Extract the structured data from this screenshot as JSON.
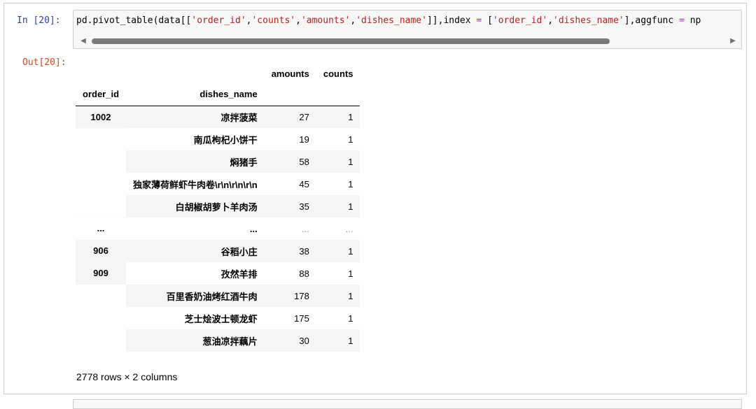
{
  "cell_in": {
    "prompt": "In  [20]:",
    "code_parts": [
      {
        "t": "pd.pivot_table(data[[",
        "c": ""
      },
      {
        "t": "'order_id'",
        "c": "str"
      },
      {
        "t": ",",
        "c": ""
      },
      {
        "t": "'counts'",
        "c": "str"
      },
      {
        "t": ",",
        "c": ""
      },
      {
        "t": "'amounts'",
        "c": "str"
      },
      {
        "t": ",",
        "c": ""
      },
      {
        "t": "'dishes_name'",
        "c": "str"
      },
      {
        "t": "]],index ",
        "c": ""
      },
      {
        "t": "=",
        "c": "op"
      },
      {
        "t": " [",
        "c": ""
      },
      {
        "t": "'order_id'",
        "c": "str"
      },
      {
        "t": ",",
        "c": ""
      },
      {
        "t": "'dishes_name'",
        "c": "str"
      },
      {
        "t": "],aggfunc ",
        "c": ""
      },
      {
        "t": "=",
        "c": "op"
      },
      {
        "t": " np",
        "c": ""
      }
    ]
  },
  "cell_out": {
    "prompt": "Out[20]:",
    "table": {
      "columns": [
        "amounts",
        "counts"
      ],
      "index_names": [
        "order_id",
        "dishes_name"
      ],
      "rows": [
        {
          "order_id": "1002",
          "dish": "凉拌菠菜",
          "amounts": "27",
          "counts": "1"
        },
        {
          "order_id": "",
          "dish": "南瓜枸杞小饼干",
          "amounts": "19",
          "counts": "1"
        },
        {
          "order_id": "",
          "dish": "焖猪手",
          "amounts": "58",
          "counts": "1"
        },
        {
          "order_id": "",
          "dish": "独家薄荷鲜虾牛肉卷\\r\\n\\r\\n\\r\\n",
          "amounts": "45",
          "counts": "1"
        },
        {
          "order_id": "",
          "dish": "白胡椒胡萝卜羊肉汤",
          "amounts": "35",
          "counts": "1"
        },
        {
          "order_id": "...",
          "dish": "...",
          "amounts": "...",
          "counts": "...",
          "ellipsis": true
        },
        {
          "order_id": "906",
          "dish": "谷稻小庄",
          "amounts": "38",
          "counts": "1"
        },
        {
          "order_id": "909",
          "dish": "孜然羊排",
          "amounts": "88",
          "counts": "1"
        },
        {
          "order_id": "",
          "dish": "百里香奶油烤红酒牛肉",
          "amounts": "178",
          "counts": "1"
        },
        {
          "order_id": "",
          "dish": "芝士烩波士顿龙虾",
          "amounts": "175",
          "counts": "1"
        },
        {
          "order_id": "",
          "dish": "葱油凉拌藕片",
          "amounts": "30",
          "counts": "1"
        }
      ]
    },
    "shape_text": "2778 rows × 2 columns"
  },
  "colors": {
    "in_prompt": "#303f9f",
    "out_prompt": "#d84315",
    "string": "#ba2121",
    "operator": "#aa22ff",
    "stripe": "#f5f5f5"
  }
}
